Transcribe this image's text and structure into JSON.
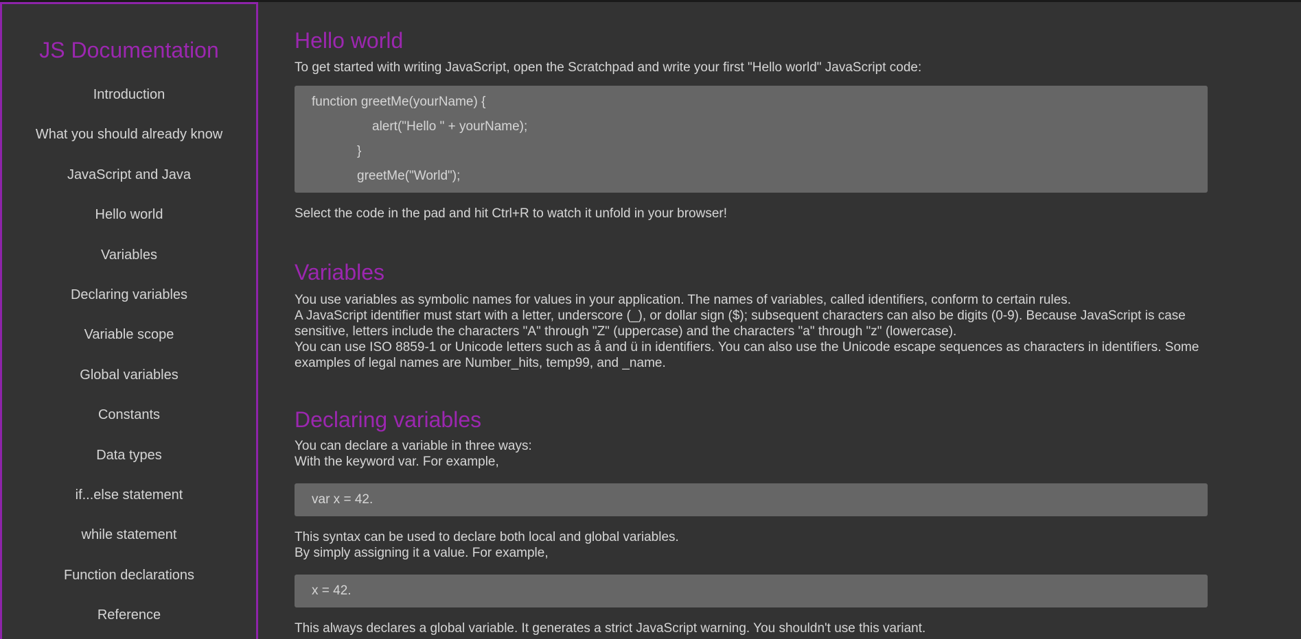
{
  "navbar": {
    "title": "JS Documentation",
    "items": [
      {
        "label": "Introduction"
      },
      {
        "label": "What you should already know"
      },
      {
        "label": "JavaScript and Java"
      },
      {
        "label": "Hello world"
      },
      {
        "label": "Variables"
      },
      {
        "label": "Declaring variables"
      },
      {
        "label": "Variable scope"
      },
      {
        "label": "Global variables"
      },
      {
        "label": "Constants"
      },
      {
        "label": "Data types"
      },
      {
        "label": "if...else statement"
      },
      {
        "label": "while statement"
      },
      {
        "label": "Function declarations"
      },
      {
        "label": "Reference"
      }
    ]
  },
  "sections": {
    "hello": {
      "title": "Hello world",
      "intro": "To get started with writing JavaScript, open the Scratchpad and write your first \"Hello world\" JavaScript code:",
      "code": [
        "function greetMe(yourName) {",
        "alert(\"Hello \" + yourName);",
        "}",
        "greetMe(\"World\");"
      ],
      "outro": "Select the code in the pad and hit Ctrl+R to watch it unfold in your browser!"
    },
    "variables": {
      "title": "Variables",
      "lines": [
        "You use variables as symbolic names for values in your application. The names of variables, called identifiers, conform to certain rules.",
        "A JavaScript identifier must start with a letter, underscore (_), or dollar sign ($); subsequent characters can also be digits (0-9). Because JavaScript is case sensitive, letters include the characters \"A\" through \"Z\" (uppercase) and the characters \"a\" through \"z\" (lowercase).",
        "You can use ISO 8859-1 or Unicode letters such as å and ü in identifiers. You can also use the Unicode escape sequences as characters in identifiers. Some examples of legal names are Number_hits, temp99, and _name."
      ]
    },
    "declaring": {
      "title": "Declaring variables",
      "line1": "You can declare a variable in three ways:",
      "line2": "With the keyword var. For example,",
      "code1": "var x = 42.",
      "line3": "This syntax can be used to declare both local and global variables.",
      "line4": "By simply assigning it a value. For example,",
      "code2": "x = 42.",
      "line5": "This always declares a global variable. It generates a strict JavaScript warning. You shouldn't use this variant."
    }
  }
}
